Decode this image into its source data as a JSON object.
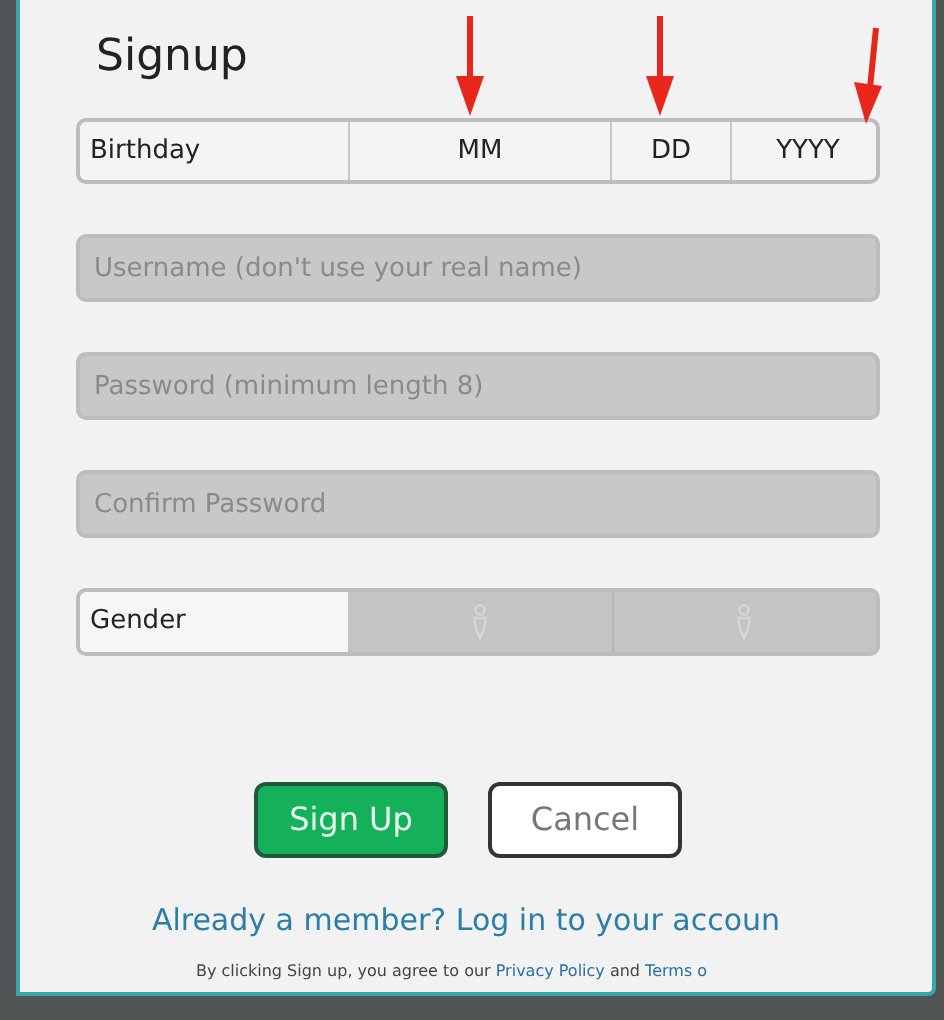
{
  "title": "Signup",
  "birthday": {
    "label": "Birthday",
    "fields": [
      {
        "placeholder": "MM"
      },
      {
        "placeholder": "DD"
      },
      {
        "placeholder": "YYYY"
      }
    ]
  },
  "inputs": [
    {
      "placeholder": "Username (don't use your real name)"
    },
    {
      "placeholder": "Password (minimum length 8)"
    },
    {
      "placeholder": "Confirm Password"
    }
  ],
  "gender": {
    "label": "Gender",
    "options": [
      {
        "selected": false
      },
      {
        "selected": false
      }
    ]
  },
  "buttons": [
    {
      "label": "Sign Up",
      "kind": "primary"
    },
    {
      "label": "Cancel",
      "kind": "secondary"
    }
  ],
  "login_link": "Already a member? Log in to your accoun",
  "legal": [
    {
      "kind": "text",
      "text": "By clicking Sign up, you agree to our "
    },
    {
      "kind": "link",
      "text": "Privacy Policy"
    },
    {
      "kind": "text",
      "text": " and "
    },
    {
      "kind": "link",
      "text": "Terms o"
    }
  ]
}
